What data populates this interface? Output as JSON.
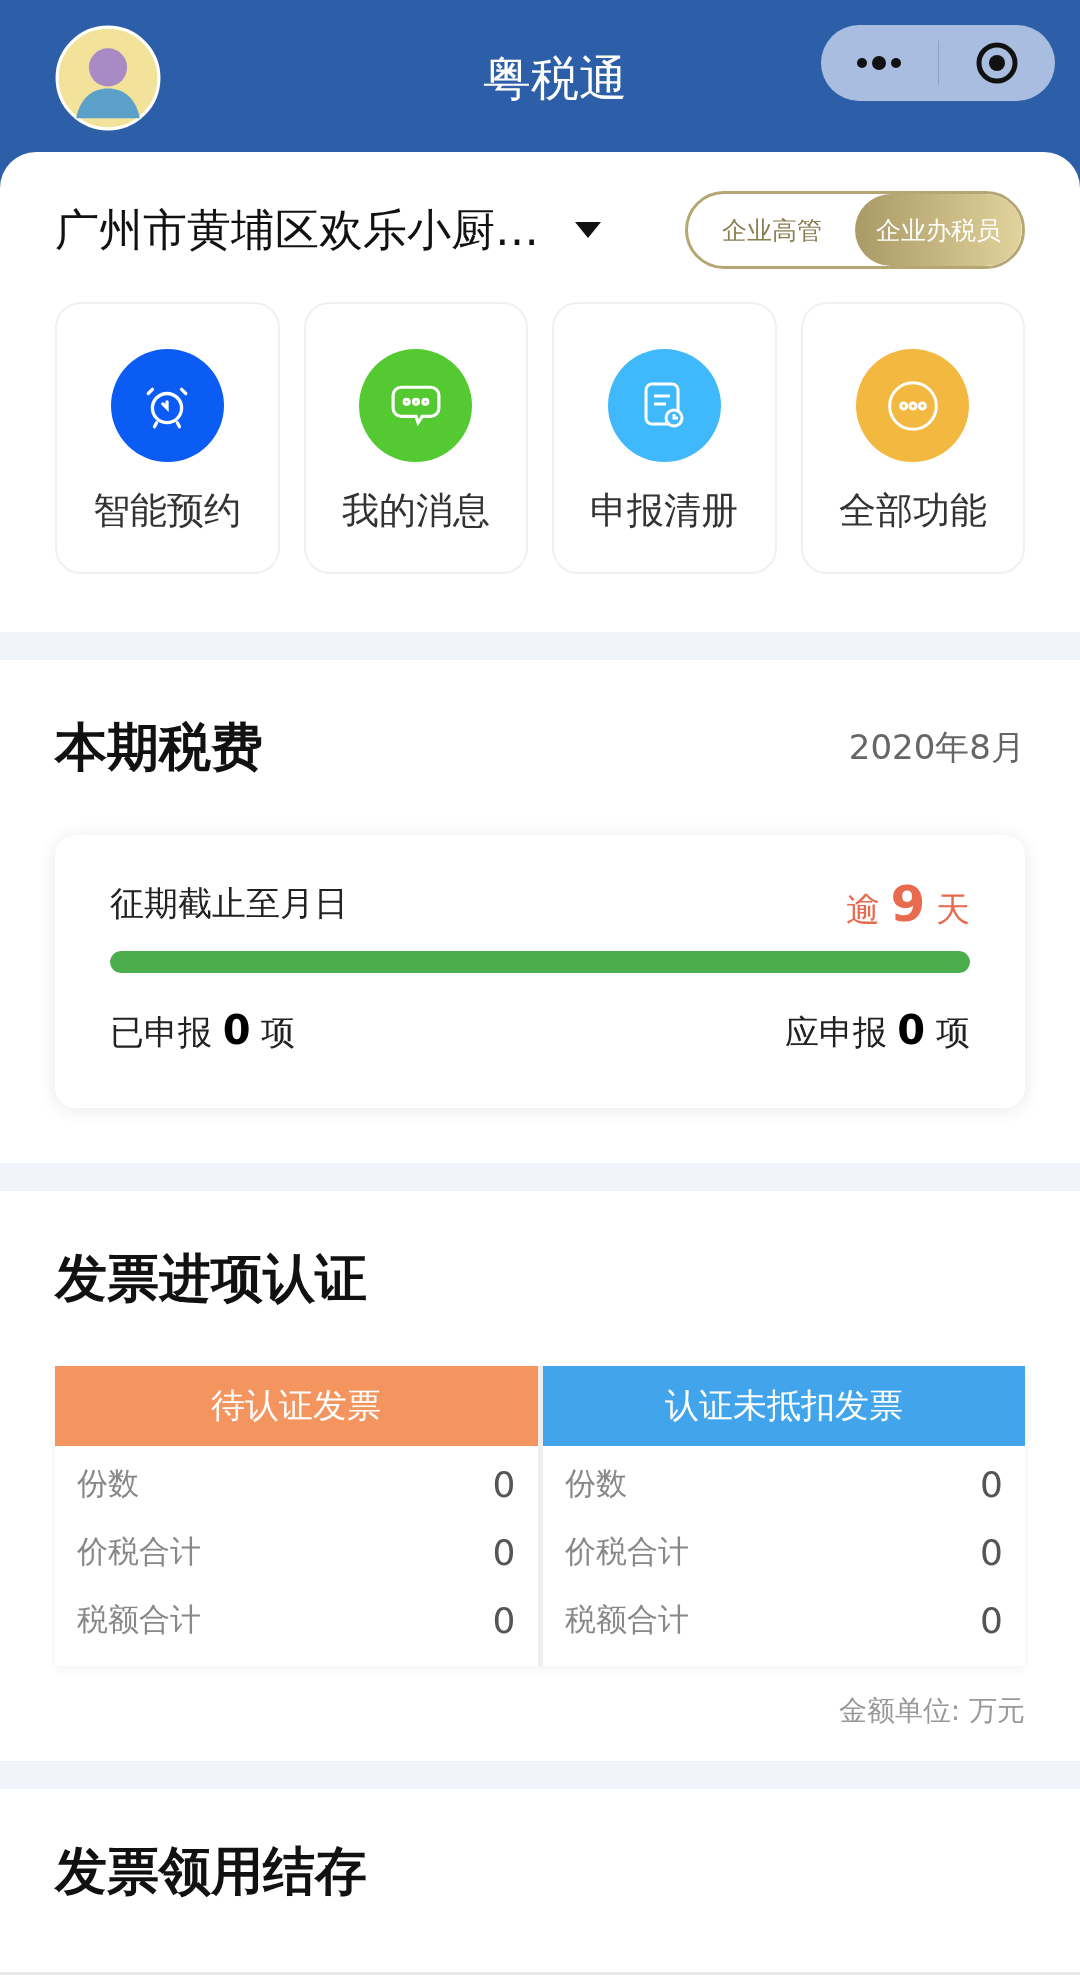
{
  "header": {
    "title": "粤税通"
  },
  "company": {
    "name": "广州市黄埔区欢乐小厨…"
  },
  "roles": [
    {
      "label": "企业高管",
      "selected": false
    },
    {
      "label": "企业办税员",
      "selected": true
    }
  ],
  "shortcuts": [
    {
      "label": "智能预约",
      "kind": "alarm",
      "color": "#0b5cf5"
    },
    {
      "label": "我的消息",
      "kind": "chat",
      "color": "#55c932"
    },
    {
      "label": "申报清册",
      "kind": "document",
      "color": "#3fb9fb"
    },
    {
      "label": "全部功能",
      "kind": "more",
      "color": "#f2b840"
    }
  ],
  "tax_period": {
    "title": "本期税费",
    "date": "2020年8月",
    "deadline": "征期截止至月日",
    "overdue": "逾 **9** 天",
    "level": 1,
    "declared": "已申报 **0** 项",
    "due": "应申报 **0** 项"
  },
  "invoice_cert": {
    "title": "发票进项认证",
    "tables": [
      {
        "heading": "待认证发票",
        "color": "#f4955f",
        "rows": [
          {
            "label": "份数",
            "value": "0"
          },
          {
            "label": "价税合计",
            "value": "0"
          },
          {
            "label": "税额合计",
            "value": "0"
          }
        ]
      },
      {
        "heading": "认证未抵扣发票",
        "color": "#42a5ec",
        "rows": [
          {
            "label": "份数",
            "value": "0"
          },
          {
            "label": "价税合计",
            "value": "0"
          },
          {
            "label": "税额合计",
            "value": "0"
          }
        ]
      }
    ],
    "note": "金额单位: 万元"
  },
  "invoice_stock": {
    "title": "发票领用结存"
  }
}
